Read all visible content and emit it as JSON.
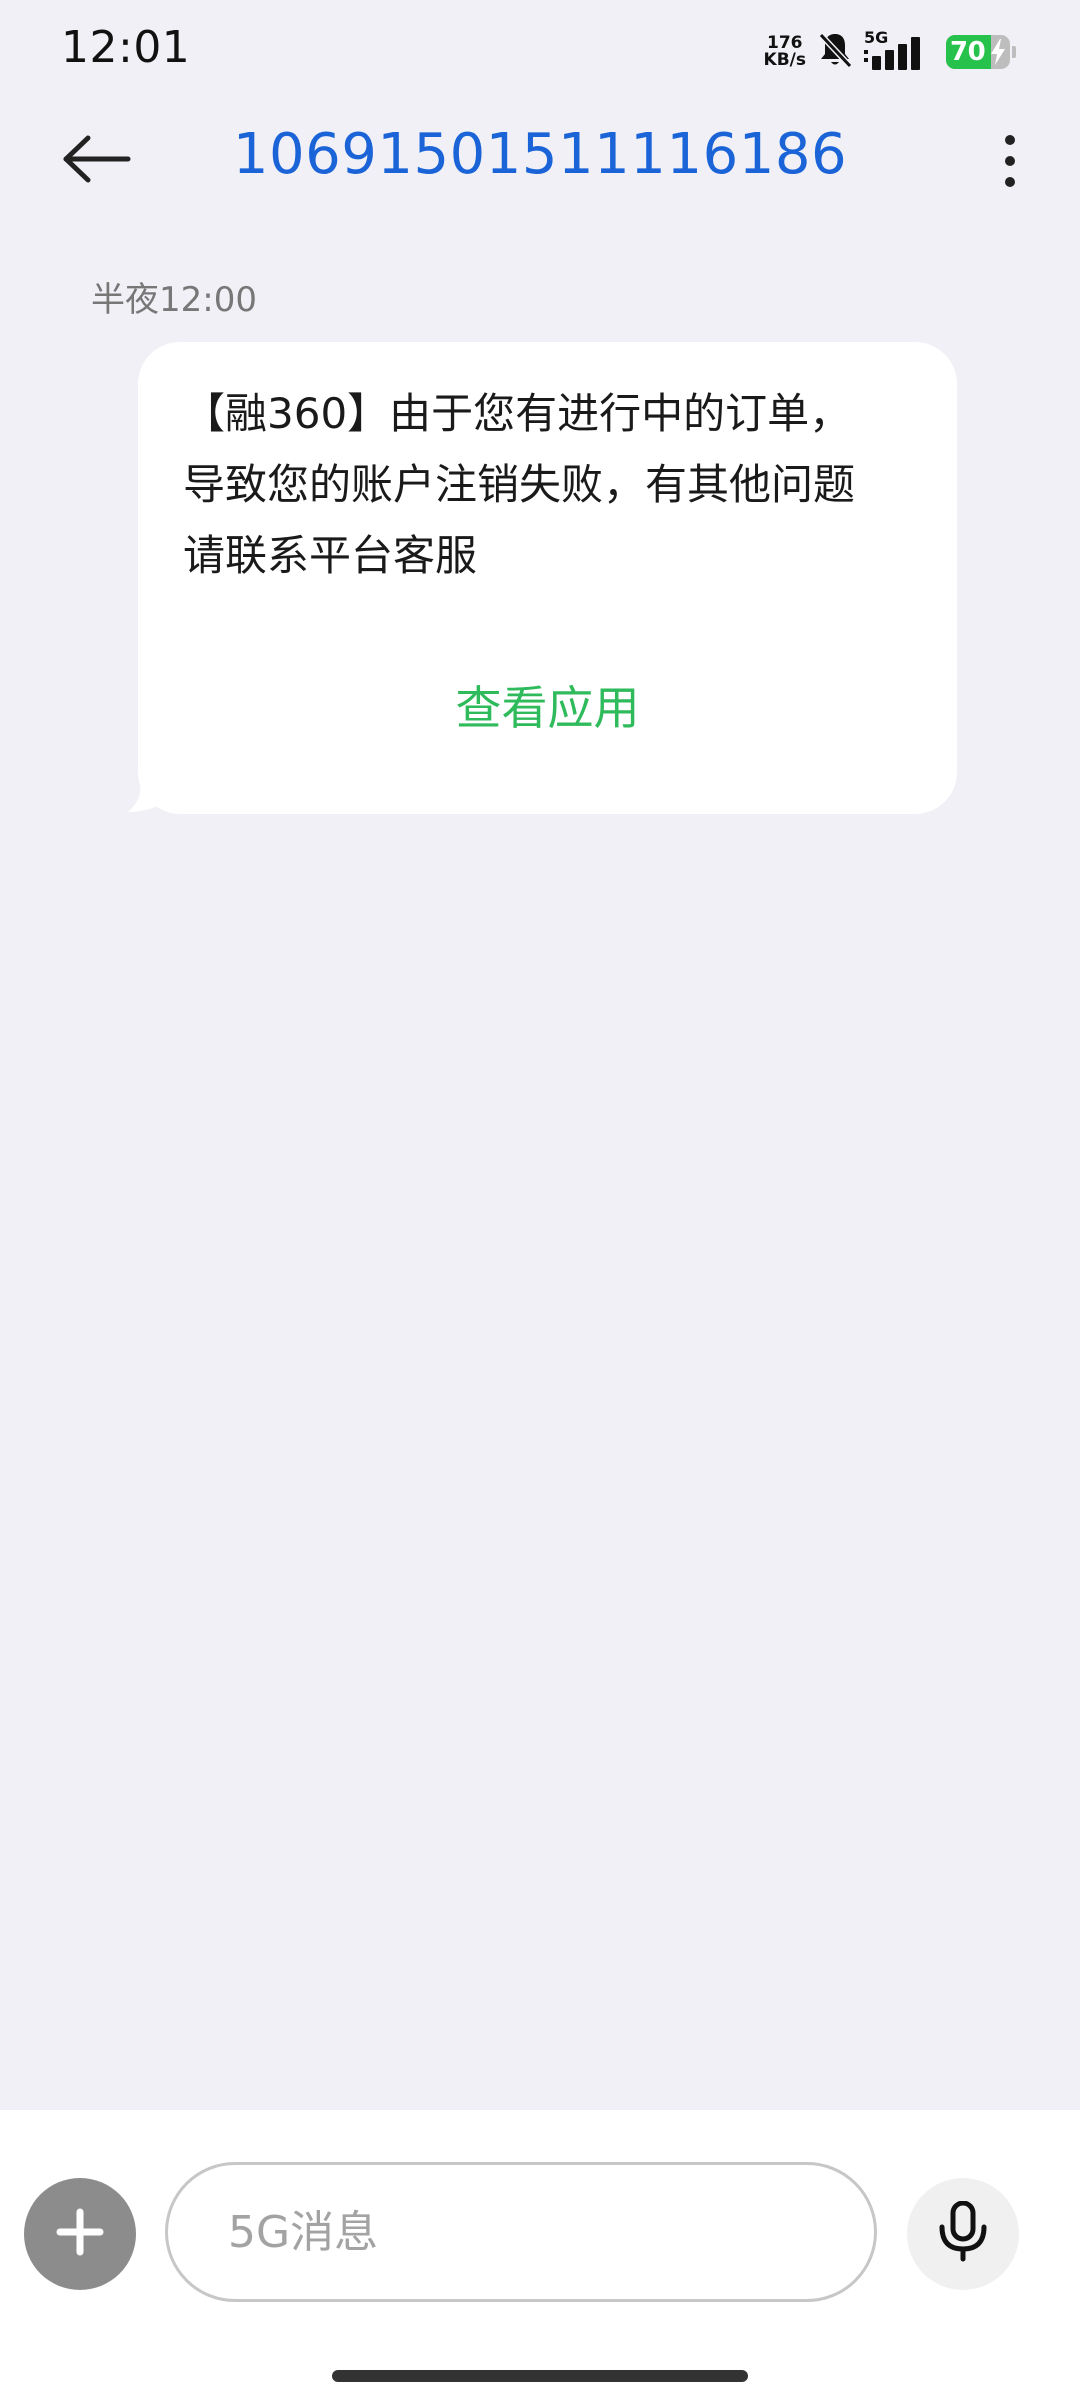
{
  "status_bar": {
    "time": "12:01",
    "net_speed_value": "176",
    "net_speed_unit": "KB/s",
    "network_type": "5G",
    "battery_level": "70",
    "icons": [
      "bell-muted-icon",
      "signal-icon",
      "battery-icon",
      "charging-bolt-icon"
    ],
    "battery_color": "#27c24c"
  },
  "header": {
    "back_icon": "arrow-left-icon",
    "title": "10691501511116186",
    "more_icon": "more-vertical-icon",
    "title_color": "#1a64d8"
  },
  "conversation": {
    "messages": [
      {
        "time": "半夜12:00",
        "lines": [
          "【融360】由于您有进行中的订单，",
          "导致您的账户注销失败，有其他问题",
          "请联系平台客服"
        ],
        "action_label": "查看应用",
        "action_color": "#2fba5b"
      }
    ]
  },
  "input_bar": {
    "add_icon": "plus-icon",
    "placeholder": "5G消息",
    "value": "",
    "mic_icon": "microphone-icon"
  }
}
